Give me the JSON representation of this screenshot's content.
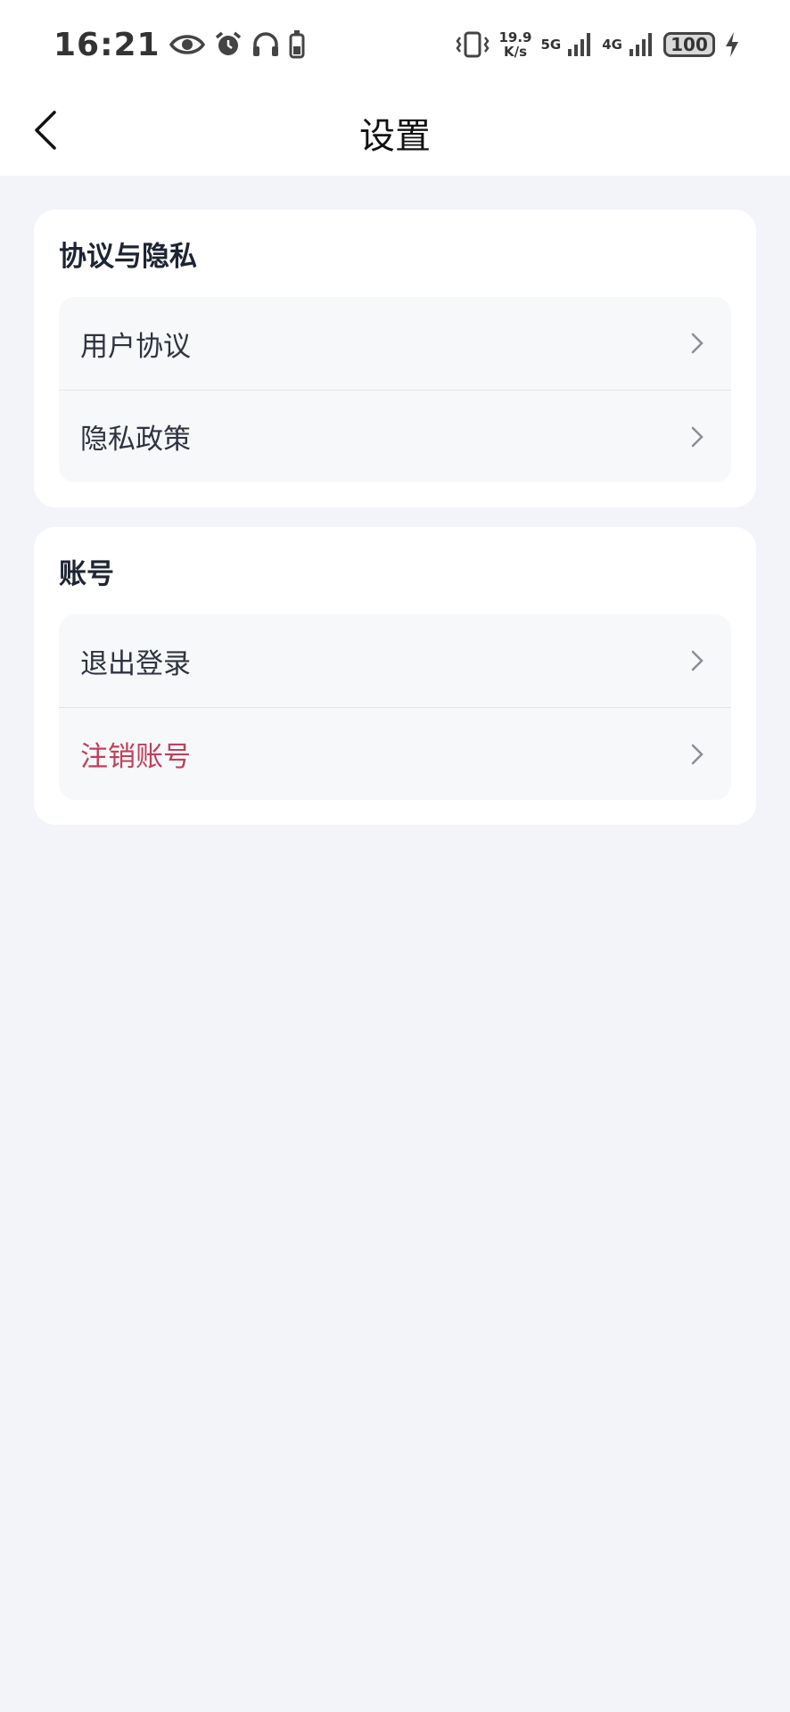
{
  "status_bar": {
    "time": "16:21",
    "icons": [
      "eye-icon",
      "alarm-icon",
      "headphones-icon",
      "battery-saver-icon"
    ],
    "speed_value": "19.9",
    "speed_unit": "K/s",
    "signal_1_label": "5G",
    "signal_2_label": "4G",
    "battery_level": "100"
  },
  "header": {
    "title": "设置",
    "back_icon": "back-arrow-icon"
  },
  "sections": [
    {
      "title": "协议与隐私",
      "items": [
        {
          "label": "用户协议"
        },
        {
          "label": "隐私政策"
        }
      ]
    },
    {
      "title": "账号",
      "items": [
        {
          "label": "退出登录"
        },
        {
          "label": "注销账号",
          "color": "#c0405a"
        }
      ]
    }
  ],
  "colors": {
    "background": "#f3f4f9",
    "card": "#ffffff",
    "list_background": "#f7f8fa",
    "danger": "#c0405a"
  }
}
